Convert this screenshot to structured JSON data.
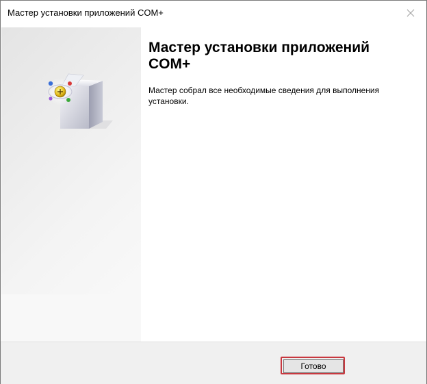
{
  "window": {
    "title": "Мастер установки приложений COM+"
  },
  "content": {
    "heading": "Мастер установки приложений COM+",
    "message": "Мастер собрал все необходимые сведения для выполнения установки."
  },
  "footer": {
    "finish_label": "Готово"
  },
  "icons": {
    "close": "close-icon",
    "wizard": "com-package-box-icon"
  },
  "colors": {
    "highlight": "#c8383f",
    "footer_bg": "#f0f0f0"
  }
}
